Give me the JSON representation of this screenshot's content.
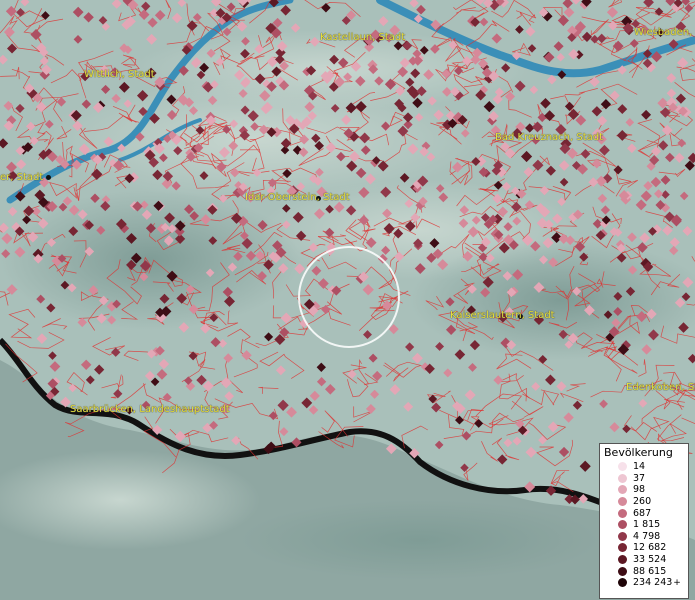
{
  "map": {
    "cities": [
      {
        "id": "kastellaun",
        "name": "Kastellaun, Stadt"
      },
      {
        "id": "wiesbaden",
        "name": "Wiesbaden,"
      },
      {
        "id": "wittlich",
        "name": "Wittlich, Stadt"
      },
      {
        "id": "bad-kreuznach",
        "name": "Bad Kreuznach, Stadt"
      },
      {
        "id": "trier",
        "name": "er, Stadt"
      },
      {
        "id": "idar-oberstein",
        "name": "Idar-Oberstein, Stadt"
      },
      {
        "id": "kaiserslautern",
        "name": "Kaiserslautern, Stadt"
      },
      {
        "id": "edenkoben",
        "name": "Edenkoben, Stad"
      },
      {
        "id": "saarbruecken",
        "name": "Saarbrücken, Landeshauptstadt"
      }
    ],
    "colors": {
      "boundary": "#e03030",
      "terrain": "#9fb8b3",
      "water": "#3b8fb8",
      "border_line": "#111111",
      "label": "#e8e23a"
    }
  },
  "legend": {
    "title": "Bevölkerung",
    "plus_marker": "+",
    "classes": [
      {
        "label": "14",
        "color": "#f7e1ea"
      },
      {
        "label": "37",
        "color": "#eec6d2"
      },
      {
        "label": "98",
        "color": "#e3a7b6"
      },
      {
        "label": "260",
        "color": "#d68a9a"
      },
      {
        "label": "687",
        "color": "#c46b7e"
      },
      {
        "label": "1 815",
        "color": "#ad4f63"
      },
      {
        "label": "4 798",
        "color": "#91384a"
      },
      {
        "label": "12 682",
        "color": "#772634"
      },
      {
        "label": "33 524",
        "color": "#5c1823"
      },
      {
        "label": "88 615",
        "color": "#3e0d15"
      },
      {
        "label": "234 243",
        "color": "#1f0508"
      }
    ]
  }
}
